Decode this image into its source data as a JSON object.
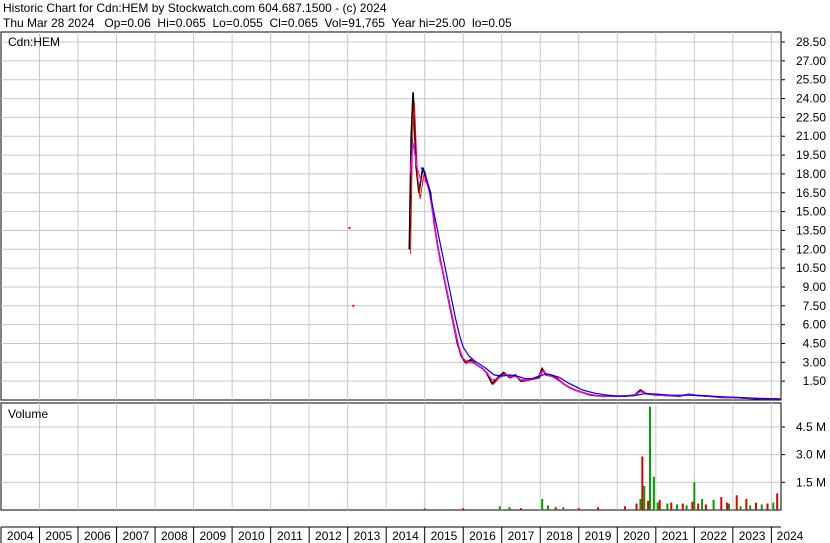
{
  "header": {
    "line1": "Historic Chart for Cdn:HEM by Stockwatch.com 604.687.1500 - (c) 2024",
    "line2": "Thu Mar 28 2024   Op=0.06  Hi=0.065  Lo=0.055  Cl=0.065  Vol=91,765  Year hi=25.00  lo=0.05"
  },
  "colors": {
    "background": "#ffffff",
    "frame": "#000000",
    "grid": "#c8c8c8",
    "price_bars": "#000000",
    "ma_short": "#ff0000",
    "ma_mid": "#ff00ff",
    "ma_long": "#0000ff",
    "volume_up": "#00a000",
    "volume_down": "#e00000"
  },
  "chart_data": [
    {
      "type": "line",
      "panel": "price",
      "title": "Cdn:HEM",
      "xlabel": "",
      "ylabel": "",
      "x_ticks": [
        "2004",
        "2005",
        "2006",
        "2007",
        "2008",
        "2009",
        "2010",
        "2011",
        "2012",
        "2013",
        "2014",
        "2015",
        "2016",
        "2017",
        "2018",
        "2019",
        "2020",
        "2021",
        "2022",
        "2023",
        "2024"
      ],
      "y_ticks": [
        "1.50",
        "3.00",
        "4.50",
        "6.00",
        "7.50",
        "9.00",
        "10.50",
        "12.00",
        "13.50",
        "15.00",
        "16.50",
        "18.00",
        "19.50",
        "21.00",
        "22.50",
        "24.00",
        "25.50",
        "27.00",
        "28.50"
      ],
      "ylim": [
        0,
        29.3
      ],
      "xlim": [
        2004.0,
        2024.25
      ],
      "grid": true,
      "series": [
        {
          "values": [
            [
              2013.05,
              13.7
            ],
            [
              2013.15,
              7.5
            ],
            [
              2014.6,
              12.0
            ],
            [
              2014.65,
              21.0
            ],
            [
              2014.7,
              24.5
            ],
            [
              2014.78,
              18.5
            ],
            [
              2014.85,
              16.5
            ],
            [
              2014.95,
              18.5
            ],
            [
              2015.05,
              17.5
            ],
            [
              2015.15,
              16.5
            ],
            [
              2015.25,
              14.0
            ],
            [
              2015.35,
              12.0
            ],
            [
              2015.45,
              10.5
            ],
            [
              2015.55,
              9.0
            ],
            [
              2015.65,
              7.5
            ],
            [
              2015.75,
              6.0
            ],
            [
              2015.85,
              4.5
            ],
            [
              2015.95,
              3.5
            ],
            [
              2016.05,
              3.0
            ],
            [
              2016.2,
              3.2
            ],
            [
              2016.35,
              2.8
            ],
            [
              2016.5,
              2.5
            ],
            [
              2016.6,
              2.2
            ],
            [
              2016.75,
              1.3
            ],
            [
              2016.9,
              1.8
            ],
            [
              2017.05,
              2.2
            ],
            [
              2017.2,
              1.8
            ],
            [
              2017.35,
              2.0
            ],
            [
              2017.5,
              1.5
            ],
            [
              2017.65,
              1.6
            ],
            [
              2017.8,
              1.7
            ],
            [
              2017.95,
              1.8
            ],
            [
              2018.05,
              2.5
            ],
            [
              2018.15,
              2.0
            ],
            [
              2018.3,
              1.9
            ],
            [
              2018.45,
              1.7
            ],
            [
              2018.6,
              1.3
            ],
            [
              2018.75,
              1.0
            ],
            [
              2018.9,
              0.8
            ],
            [
              2019.1,
              0.6
            ],
            [
              2019.3,
              0.4
            ],
            [
              2019.6,
              0.3
            ],
            [
              2019.9,
              0.3
            ],
            [
              2020.2,
              0.3
            ],
            [
              2020.45,
              0.4
            ],
            [
              2020.6,
              0.8
            ],
            [
              2020.75,
              0.5
            ],
            [
              2021.0,
              0.4
            ],
            [
              2021.3,
              0.35
            ],
            [
              2021.6,
              0.3
            ],
            [
              2021.85,
              0.45
            ],
            [
              2022.1,
              0.35
            ],
            [
              2022.4,
              0.3
            ],
            [
              2022.7,
              0.2
            ],
            [
              2023.0,
              0.2
            ],
            [
              2023.3,
              0.15
            ],
            [
              2023.6,
              0.1
            ],
            [
              2023.9,
              0.08
            ],
            [
              2024.1,
              0.07
            ],
            [
              2024.24,
              0.065
            ]
          ]
        },
        {
          "values": [
            [
              2014.62,
              18.0
            ],
            [
              2014.7,
              20.5
            ],
            [
              2014.8,
              18.5
            ],
            [
              2014.9,
              17.5
            ],
            [
              2015.0,
              17.5
            ],
            [
              2015.1,
              17.0
            ],
            [
              2015.2,
              15.0
            ],
            [
              2015.3,
              13.0
            ],
            [
              2015.4,
              11.0
            ],
            [
              2015.5,
              9.8
            ],
            [
              2015.6,
              8.3
            ],
            [
              2015.7,
              6.8
            ],
            [
              2015.8,
              5.3
            ],
            [
              2015.9,
              4.0
            ],
            [
              2016.0,
              3.3
            ],
            [
              2016.15,
              3.0
            ],
            [
              2016.3,
              2.9
            ],
            [
              2016.45,
              2.6
            ],
            [
              2016.6,
              2.2
            ],
            [
              2016.75,
              1.6
            ],
            [
              2016.9,
              1.7
            ],
            [
              2017.05,
              2.0
            ],
            [
              2017.2,
              1.9
            ],
            [
              2017.35,
              1.9
            ],
            [
              2017.5,
              1.6
            ],
            [
              2017.65,
              1.6
            ],
            [
              2017.8,
              1.7
            ],
            [
              2017.95,
              1.9
            ],
            [
              2018.05,
              2.3
            ],
            [
              2018.2,
              2.0
            ],
            [
              2018.35,
              1.8
            ],
            [
              2018.5,
              1.5
            ],
            [
              2018.65,
              1.2
            ],
            [
              2018.8,
              0.9
            ],
            [
              2019.0,
              0.65
            ],
            [
              2019.3,
              0.45
            ],
            [
              2019.6,
              0.3
            ],
            [
              2020.0,
              0.3
            ],
            [
              2020.4,
              0.35
            ],
            [
              2020.6,
              0.65
            ],
            [
              2020.8,
              0.5
            ],
            [
              2021.1,
              0.4
            ],
            [
              2021.5,
              0.32
            ],
            [
              2021.85,
              0.42
            ],
            [
              2022.2,
              0.33
            ],
            [
              2022.6,
              0.25
            ],
            [
              2023.0,
              0.2
            ],
            [
              2023.5,
              0.13
            ],
            [
              2023.9,
              0.09
            ],
            [
              2024.24,
              0.07
            ]
          ]
        },
        {
          "values": [
            [
              2014.9,
              18.5
            ],
            [
              2015.0,
              18.2
            ],
            [
              2015.1,
              17.0
            ],
            [
              2015.2,
              15.5
            ],
            [
              2015.3,
              14.0
            ],
            [
              2015.4,
              12.5
            ],
            [
              2015.5,
              11.0
            ],
            [
              2015.6,
              9.5
            ],
            [
              2015.7,
              8.0
            ],
            [
              2015.8,
              6.5
            ],
            [
              2015.9,
              5.2
            ],
            [
              2016.0,
              4.2
            ],
            [
              2016.15,
              3.5
            ],
            [
              2016.3,
              3.1
            ],
            [
              2016.45,
              2.8
            ],
            [
              2016.6,
              2.5
            ],
            [
              2016.8,
              2.0
            ],
            [
              2017.0,
              1.9
            ],
            [
              2017.2,
              2.0
            ],
            [
              2017.4,
              1.9
            ],
            [
              2017.6,
              1.7
            ],
            [
              2017.8,
              1.7
            ],
            [
              2018.0,
              1.9
            ],
            [
              2018.15,
              2.1
            ],
            [
              2018.3,
              2.0
            ],
            [
              2018.5,
              1.8
            ],
            [
              2018.7,
              1.4
            ],
            [
              2018.9,
              1.1
            ],
            [
              2019.1,
              0.8
            ],
            [
              2019.4,
              0.55
            ],
            [
              2019.7,
              0.4
            ],
            [
              2020.0,
              0.32
            ],
            [
              2020.4,
              0.33
            ],
            [
              2020.7,
              0.5
            ],
            [
              2021.0,
              0.48
            ],
            [
              2021.4,
              0.38
            ],
            [
              2021.8,
              0.38
            ],
            [
              2022.2,
              0.35
            ],
            [
              2022.6,
              0.28
            ],
            [
              2023.0,
              0.22
            ],
            [
              2023.5,
              0.15
            ],
            [
              2024.0,
              0.1
            ],
            [
              2024.24,
              0.08
            ]
          ]
        }
      ]
    },
    {
      "type": "bar",
      "panel": "volume",
      "title": "Volume",
      "xlabel": "",
      "ylabel": "",
      "y_ticks": [
        "1.5 M",
        "3.0 M",
        "4.5 M"
      ],
      "ylim": [
        0,
        5.8
      ],
      "xlim": [
        2004.0,
        2024.25
      ],
      "grid": true,
      "series": [
        {
          "values": [
            [
              2016.95,
              0.2
            ],
            [
              2017.2,
              0.15
            ],
            [
              2018.05,
              0.6
            ],
            [
              2018.2,
              0.25
            ],
            [
              2018.6,
              0.15
            ],
            [
              2020.6,
              0.6
            ],
            [
              2020.7,
              1.3
            ],
            [
              2020.85,
              5.6
            ],
            [
              2020.95,
              1.8
            ],
            [
              2021.05,
              0.4
            ],
            [
              2021.3,
              0.35
            ],
            [
              2021.55,
              0.3
            ],
            [
              2021.8,
              0.25
            ],
            [
              2022.0,
              1.5
            ],
            [
              2022.2,
              0.6
            ],
            [
              2022.5,
              0.55
            ],
            [
              2022.9,
              0.35
            ],
            [
              2023.2,
              0.2
            ],
            [
              2023.45,
              0.25
            ],
            [
              2023.75,
              0.3
            ],
            [
              2024.05,
              0.4
            ]
          ]
        },
        {
          "values": [
            [
              2013.0,
              0.03
            ],
            [
              2015.0,
              0.08
            ],
            [
              2016.0,
              0.1
            ],
            [
              2017.5,
              0.1
            ],
            [
              2018.4,
              0.15
            ],
            [
              2019.0,
              0.1
            ],
            [
              2019.5,
              0.15
            ],
            [
              2020.2,
              0.2
            ],
            [
              2020.5,
              0.35
            ],
            [
              2020.65,
              2.9
            ],
            [
              2020.8,
              0.5
            ],
            [
              2021.1,
              0.55
            ],
            [
              2021.4,
              0.4
            ],
            [
              2021.7,
              0.35
            ],
            [
              2021.95,
              0.45
            ],
            [
              2022.1,
              0.35
            ],
            [
              2022.3,
              0.3
            ],
            [
              2022.7,
              0.7
            ],
            [
              2022.85,
              0.4
            ],
            [
              2023.1,
              0.8
            ],
            [
              2023.35,
              0.6
            ],
            [
              2023.6,
              0.4
            ],
            [
              2023.9,
              0.35
            ],
            [
              2024.15,
              0.9
            ]
          ]
        }
      ]
    }
  ]
}
